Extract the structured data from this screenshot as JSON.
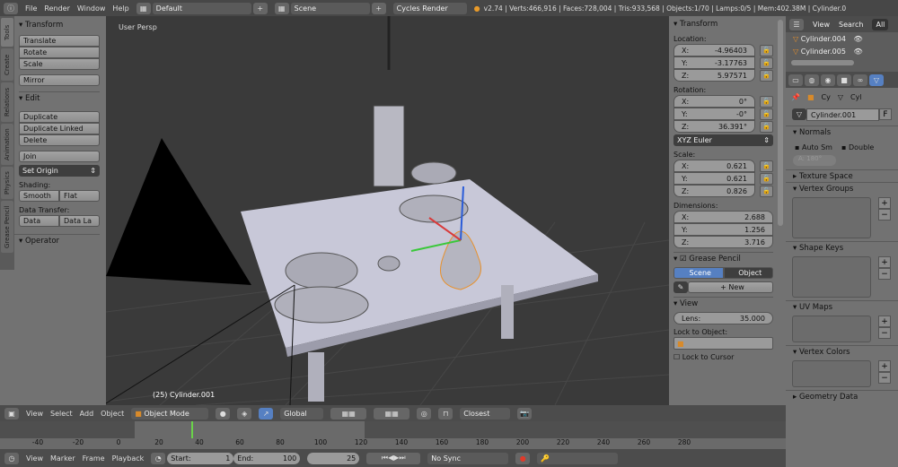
{
  "topbar": {
    "menus": [
      "File",
      "Render",
      "Window",
      "Help"
    ],
    "layout": "Default",
    "scene": "Scene",
    "engine": "Cycles Render",
    "stats": "v2.74 | Verts:466,916 | Faces:728,004 | Tris:933,568 | Objects:1/70 | Lamps:0/5 | Mem:402.38M | Cylinder.0"
  },
  "tabs": [
    "Tools",
    "Create",
    "Relations",
    "Animation",
    "Physics",
    "Grease Pencil"
  ],
  "tools": {
    "transform": "Transform",
    "translate": "Translate",
    "rotate": "Rotate",
    "scale": "Scale",
    "mirror": "Mirror",
    "edit": "Edit",
    "duplicate": "Duplicate",
    "duplicate_linked": "Duplicate Linked",
    "delete": "Delete",
    "join": "Join",
    "set_origin": "Set Origin",
    "shading": "Shading:",
    "smooth": "Smooth",
    "flat": "Flat",
    "data_transfer": "Data Transfer:",
    "data": "Data",
    "data_la": "Data La",
    "operator": "Operator"
  },
  "viewport": {
    "label": "User Persp",
    "object": "(25) Cylinder.001"
  },
  "npanel": {
    "transform": "Transform",
    "location_label": "Location:",
    "location": [
      [
        "X:",
        "-4.96403"
      ],
      [
        "Y:",
        "-3.17763"
      ],
      [
        "Z:",
        "5.97571"
      ]
    ],
    "rotation_label": "Rotation:",
    "rotation": [
      [
        "X:",
        "0°"
      ],
      [
        "Y:",
        "-0°"
      ],
      [
        "Z:",
        "36.391°"
      ]
    ],
    "rot_mode": "XYZ Euler",
    "scale_label": "Scale:",
    "scale": [
      [
        "X:",
        "0.621"
      ],
      [
        "Y:",
        "0.621"
      ],
      [
        "Z:",
        "0.826"
      ]
    ],
    "dimensions_label": "Dimensions:",
    "dimensions": [
      [
        "X:",
        "2.688"
      ],
      [
        "Y:",
        "1.256"
      ],
      [
        "Z:",
        "3.716"
      ]
    ],
    "grease_pencil": "Grease Pencil",
    "scene": "Scene",
    "object": "Object",
    "new": "New",
    "view": "View",
    "lens_label": "Lens:",
    "lens": "35.000",
    "lock_object": "Lock to Object:",
    "lock_cursor": "Lock to Cursor"
  },
  "outliner": {
    "view": "View",
    "search": "Search",
    "all": "All",
    "items": [
      "Cylinder.004",
      "Cylinder.005"
    ]
  },
  "props": {
    "crumbs": [
      "Cy",
      "Cyl"
    ],
    "mesh_name": "Cylinder.001",
    "fake": "F",
    "normals": "Normals",
    "auto_smooth": "Auto Sm",
    "double": "Double",
    "angle": "A: 180°",
    "texture_space": "Texture Space",
    "vertex_groups": "Vertex Groups",
    "shape_keys": "Shape Keys",
    "uv_maps": "UV Maps",
    "vertex_colors": "Vertex Colors",
    "geometry_data": "Geometry Data"
  },
  "view_header": {
    "menus": [
      "View",
      "Select",
      "Add",
      "Object"
    ],
    "mode": "Object Mode",
    "orientation": "Global",
    "snap": "Closest"
  },
  "timeline": {
    "ticks": [
      "-40",
      "-20",
      "0",
      "20",
      "40",
      "60",
      "80",
      "100",
      "120",
      "140",
      "160",
      "180",
      "200",
      "220",
      "240",
      "260",
      "280"
    ],
    "current_frame": 25,
    "range": [
      0,
      100
    ]
  },
  "timeline_header": {
    "menus": [
      "View",
      "Marker",
      "Frame",
      "Playback"
    ],
    "start_label": "Start:",
    "start": "1",
    "end_label": "End:",
    "end": "100",
    "frame": "25",
    "sync": "No Sync"
  }
}
